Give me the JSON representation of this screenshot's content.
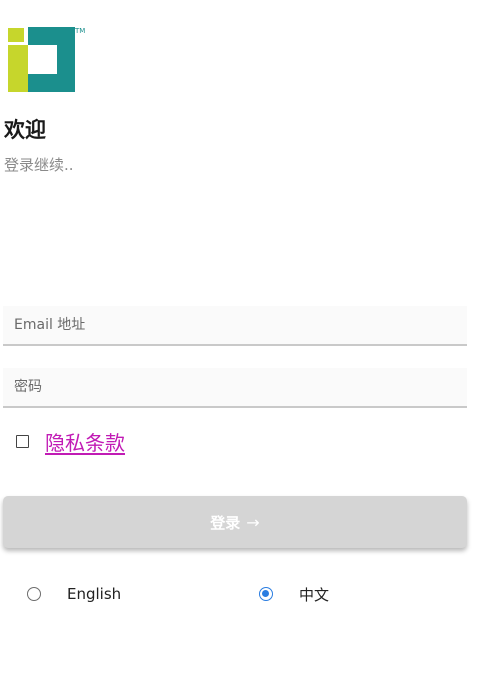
{
  "logo": {
    "icon": "id-logo-icon",
    "trademark": "TM",
    "colors": {
      "green": "#c6d62c",
      "teal": "#1b8f8d"
    }
  },
  "header": {
    "title": "欢迎",
    "subtitle": "登录继续.."
  },
  "form": {
    "email_placeholder": "Email 地址",
    "password_placeholder": "密码",
    "privacy_label": "隐私条款",
    "privacy_checked": false,
    "login_label": "登录",
    "login_arrow": "→"
  },
  "language": {
    "options": [
      {
        "label": "English",
        "selected": false
      },
      {
        "label": "中文",
        "selected": true
      }
    ],
    "accent": "#2a7de1"
  },
  "colors": {
    "link": "#c11bb5",
    "button_bg": "#d5d5d5"
  }
}
